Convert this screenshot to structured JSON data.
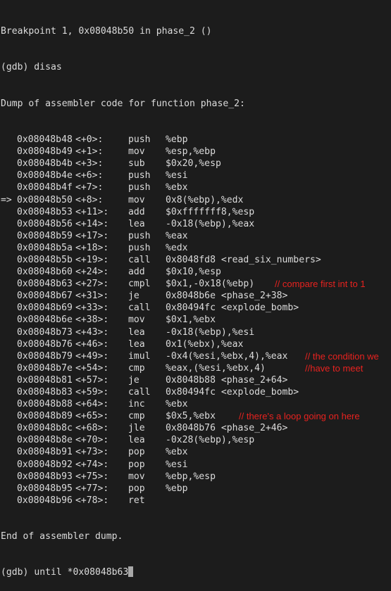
{
  "terminal": {
    "breakpoint_line": "Breakpoint 1, 0x08048b50 in phase_2 ()",
    "command1": "(gdb) disas",
    "dump_header": "Dump of assembler code for function phase_2:",
    "instructions": [
      {
        "arrow": "",
        "addr": "0x08048b48",
        "off": "<+0>:",
        "mn": "push",
        "ops": "%ebp",
        "comment": ""
      },
      {
        "arrow": "",
        "addr": "0x08048b49",
        "off": "<+1>:",
        "mn": "mov",
        "ops": "%esp,%ebp",
        "comment": ""
      },
      {
        "arrow": "",
        "addr": "0x08048b4b",
        "off": "<+3>:",
        "mn": "sub",
        "ops": "$0x20,%esp",
        "comment": ""
      },
      {
        "arrow": "",
        "addr": "0x08048b4e",
        "off": "<+6>:",
        "mn": "push",
        "ops": "%esi",
        "comment": ""
      },
      {
        "arrow": "",
        "addr": "0x08048b4f",
        "off": "<+7>:",
        "mn": "push",
        "ops": "%ebx",
        "comment": ""
      },
      {
        "arrow": "=>",
        "addr": "0x08048b50",
        "off": "<+8>:",
        "mn": "mov",
        "ops": "0x8(%ebp),%edx",
        "comment": ""
      },
      {
        "arrow": "",
        "addr": "0x08048b53",
        "off": "<+11>:",
        "mn": "add",
        "ops": "$0xfffffff8,%esp",
        "comment": ""
      },
      {
        "arrow": "",
        "addr": "0x08048b56",
        "off": "<+14>:",
        "mn": "lea",
        "ops": "-0x18(%ebp),%eax",
        "comment": ""
      },
      {
        "arrow": "",
        "addr": "0x08048b59",
        "off": "<+17>:",
        "mn": "push",
        "ops": "%eax",
        "comment": ""
      },
      {
        "arrow": "",
        "addr": "0x08048b5a",
        "off": "<+18>:",
        "mn": "push",
        "ops": "%edx",
        "comment": ""
      },
      {
        "arrow": "",
        "addr": "0x08048b5b",
        "off": "<+19>:",
        "mn": "call",
        "ops": "0x8048fd8 <read_six_numbers>",
        "comment": ""
      },
      {
        "arrow": "",
        "addr": "0x08048b60",
        "off": "<+24>:",
        "mn": "add",
        "ops": "$0x10,%esp",
        "comment": ""
      },
      {
        "arrow": "",
        "addr": "0x08048b63",
        "off": "<+27>:",
        "mn": "cmpl",
        "ops": "$0x1,-0x18(%ebp)",
        "comment": "// compare first int to 1"
      },
      {
        "arrow": "",
        "addr": "0x08048b67",
        "off": "<+31>:",
        "mn": "je",
        "ops": "0x8048b6e <phase_2+38>",
        "comment": ""
      },
      {
        "arrow": "",
        "addr": "0x08048b69",
        "off": "<+33>:",
        "mn": "call",
        "ops": "0x80494fc <explode_bomb>",
        "comment": ""
      },
      {
        "arrow": "",
        "addr": "0x08048b6e",
        "off": "<+38>:",
        "mn": "mov",
        "ops": "$0x1,%ebx",
        "comment": ""
      },
      {
        "arrow": "",
        "addr": "0x08048b73",
        "off": "<+43>:",
        "mn": "lea",
        "ops": "-0x18(%ebp),%esi",
        "comment": ""
      },
      {
        "arrow": "",
        "addr": "0x08048b76",
        "off": "<+46>:",
        "mn": "lea",
        "ops": "0x1(%ebx),%eax",
        "comment": ""
      },
      {
        "arrow": "",
        "addr": "0x08048b79",
        "off": "<+49>:",
        "mn": "imul",
        "ops": "-0x4(%esi,%ebx,4),%eax",
        "comment": "// the condition we"
      },
      {
        "arrow": "",
        "addr": "0x08048b7e",
        "off": "<+54>:",
        "mn": "cmp",
        "ops": "%eax,(%esi,%ebx,4)",
        "comment": "//have to meet"
      },
      {
        "arrow": "",
        "addr": "0x08048b81",
        "off": "<+57>:",
        "mn": "je",
        "ops": "0x8048b88 <phase_2+64>",
        "comment": ""
      },
      {
        "arrow": "",
        "addr": "0x08048b83",
        "off": "<+59>:",
        "mn": "call",
        "ops": "0x80494fc <explode_bomb>",
        "comment": ""
      },
      {
        "arrow": "",
        "addr": "0x08048b88",
        "off": "<+64>:",
        "mn": "inc",
        "ops": "%ebx",
        "comment": ""
      },
      {
        "arrow": "",
        "addr": "0x08048b89",
        "off": "<+65>:",
        "mn": "cmp",
        "ops": "$0x5,%ebx",
        "comment": "// there's a loop going on here"
      },
      {
        "arrow": "",
        "addr": "0x08048b8c",
        "off": "<+68>:",
        "mn": "jle",
        "ops": "0x8048b76 <phase_2+46>",
        "comment": ""
      },
      {
        "arrow": "",
        "addr": "0x08048b8e",
        "off": "<+70>:",
        "mn": "lea",
        "ops": "-0x28(%ebp),%esp",
        "comment": ""
      },
      {
        "arrow": "",
        "addr": "0x08048b91",
        "off": "<+73>:",
        "mn": "pop",
        "ops": "%ebx",
        "comment": ""
      },
      {
        "arrow": "",
        "addr": "0x08048b92",
        "off": "<+74>:",
        "mn": "pop",
        "ops": "%esi",
        "comment": ""
      },
      {
        "arrow": "",
        "addr": "0x08048b93",
        "off": "<+75>:",
        "mn": "mov",
        "ops": "%ebp,%esp",
        "comment": ""
      },
      {
        "arrow": "",
        "addr": "0x08048b95",
        "off": "<+77>:",
        "mn": "pop",
        "ops": "%ebp",
        "comment": ""
      },
      {
        "arrow": "",
        "addr": "0x08048b96",
        "off": "<+78>:",
        "mn": "ret",
        "ops": "",
        "comment": ""
      }
    ],
    "dump_footer": "End of assembler dump.",
    "prompt": "(gdb) ",
    "current_input": "until *0x08048b63"
  },
  "colors": {
    "background": "#1c1c1c",
    "text": "#dcdcdc",
    "comment": "#e8221f",
    "cursor": "#a8a8a8"
  }
}
